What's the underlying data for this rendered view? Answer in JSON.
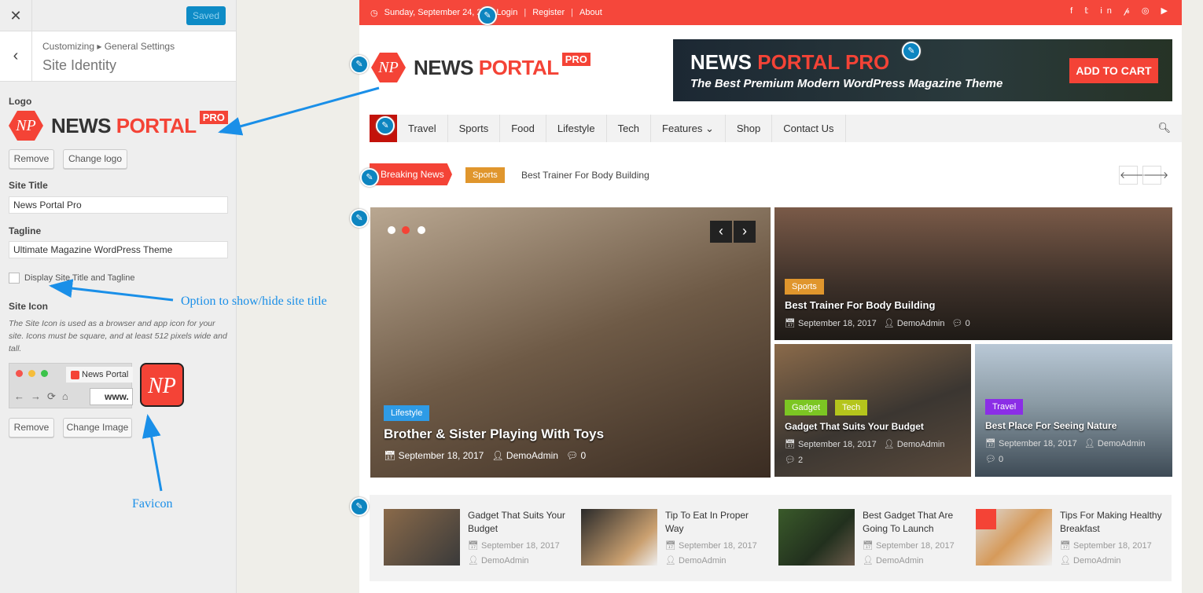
{
  "customizer": {
    "close_icon": "close-icon",
    "saved_label": "Saved",
    "breadcrumb": "Customizing ▸ General Settings",
    "section_title": "Site Identity",
    "logo_label": "Logo",
    "logo": {
      "mark": "NP",
      "word1": "NEWS",
      "word2": "PORTAL",
      "badge": "PRO"
    },
    "remove_label": "Remove",
    "change_logo_label": "Change logo",
    "site_title_label": "Site Title",
    "site_title_value": "News Portal Pro",
    "tagline_label": "Tagline",
    "tagline_value": "Ultimate Magazine WordPress Theme",
    "display_checkbox_label": "Display Site Title and Tagline",
    "display_checked": false,
    "site_icon_label": "Site Icon",
    "site_icon_desc": "The Site Icon is used as a browser and app icon for your site. Icons must be square, and at least 512 pixels wide and tall.",
    "preview_tab_label": "News Portal",
    "preview_url": "www.",
    "icon_mark": "NP",
    "remove_image_label": "Remove",
    "change_image_label": "Change Image"
  },
  "annotations": {
    "option_note": "Option to show/hide site title",
    "favicon_note": "Favicon",
    "arrow_color": "#1a8fe8"
  },
  "site": {
    "accent": "#f44336",
    "topbar": {
      "date": "Sunday, September 24, 2",
      "links": [
        "Login",
        "Register",
        "About"
      ],
      "social": "f 𝕥 in 𝓅 ◎ ▶"
    },
    "banner": {
      "title1": "NEWS",
      "title2": "PORTAL PRO",
      "subtitle": "The Best Premium Modern WordPress Magazine Theme",
      "cta": "ADD TO CART"
    },
    "nav": [
      "Travel",
      "Sports",
      "Food",
      "Lifestyle",
      "Tech",
      "Features ⌄",
      "Shop",
      "Contact Us"
    ],
    "breaking": {
      "label": "Breaking News",
      "tag": "Sports",
      "headline": "Best Trainer For Body Building",
      "prev": "🡐",
      "next": "🡒"
    },
    "slider": {
      "tag": "Lifestyle",
      "title": "Brother & Sister Playing With Toys",
      "date": "September 18, 2017",
      "author": "DemoAdmin",
      "comments": "0",
      "prev": "‹",
      "next": "›"
    },
    "featured": [
      {
        "tags": [
          "Sports"
        ],
        "title": "Best Trainer For Body Building",
        "date": "September 18, 2017",
        "author": "DemoAdmin",
        "comments": "0"
      },
      {
        "tags": [
          "Gadget",
          "Tech"
        ],
        "title": "Gadget That Suits Your Budget",
        "date": "September 18, 2017",
        "author": "DemoAdmin",
        "comments": "2"
      },
      {
        "tags": [
          "Travel"
        ],
        "title": "Best Place For Seeing Nature",
        "date": "September 18, 2017",
        "author": "DemoAdmin",
        "comments": "0"
      }
    ],
    "strip": [
      {
        "title": "Gadget That Suits Your Budget",
        "date": "September 18, 2017",
        "author": "DemoAdmin"
      },
      {
        "title": "Tip To Eat In Proper Way",
        "date": "September 18, 2017",
        "author": "DemoAdmin"
      },
      {
        "title": "Best Gadget That Are Going To Launch",
        "date": "September 18, 2017",
        "author": "DemoAdmin"
      },
      {
        "title": "Tips For Making Healthy Breakfast",
        "date": "September 18, 2017",
        "author": "DemoAdmin"
      }
    ]
  }
}
